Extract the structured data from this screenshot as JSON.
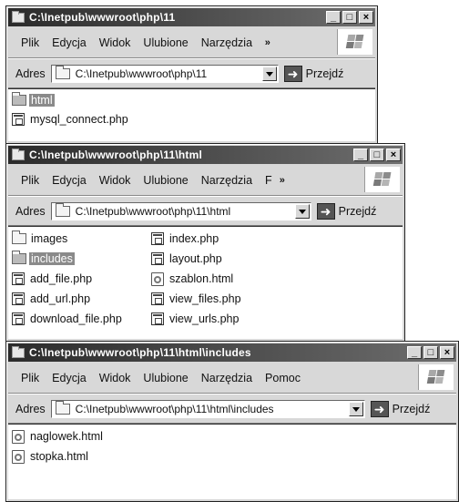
{
  "menu_labels": [
    "Plik",
    "Edycja",
    "Widok",
    "Ulubione",
    "Narzędzia"
  ],
  "address_label": "Adres",
  "go_label": "Przejdź",
  "title_buttons": {
    "minimize": "_",
    "maximize": "□",
    "close": "×"
  },
  "window1": {
    "title": "C:\\Inetpub\\wwwroot\\php\\11",
    "menu_overflow": "»",
    "address": "C:\\Inetpub\\wwwroot\\php\\11",
    "files": [
      {
        "name": "html",
        "type": "folder",
        "selected": true
      },
      {
        "name": "mysql_connect.php",
        "type": "php"
      }
    ]
  },
  "window2": {
    "title": "C:\\Inetpub\\wwwroot\\php\\11\\html",
    "menu_extra": "F",
    "menu_overflow": "»",
    "address": "C:\\Inetpub\\wwwroot\\php\\11\\html",
    "files": [
      {
        "name": "images",
        "type": "folder"
      },
      {
        "name": "includes",
        "type": "folder",
        "selected": true
      },
      {
        "name": "add_file.php",
        "type": "php"
      },
      {
        "name": "add_url.php",
        "type": "php"
      },
      {
        "name": "download_file.php",
        "type": "php"
      },
      {
        "name": "index.php",
        "type": "php"
      },
      {
        "name": "layout.php",
        "type": "php"
      },
      {
        "name": "szablon.html",
        "type": "html"
      },
      {
        "name": "view_files.php",
        "type": "php"
      },
      {
        "name": "view_urls.php",
        "type": "php"
      }
    ]
  },
  "window3": {
    "title": "C:\\Inetpub\\wwwroot\\php\\11\\html\\includes",
    "menu_extra": "Pomoc",
    "address": "C:\\Inetpub\\wwwroot\\php\\11\\html\\includes",
    "files": [
      {
        "name": "naglowek.html",
        "type": "html"
      },
      {
        "name": "stopka.html",
        "type": "html"
      }
    ]
  }
}
